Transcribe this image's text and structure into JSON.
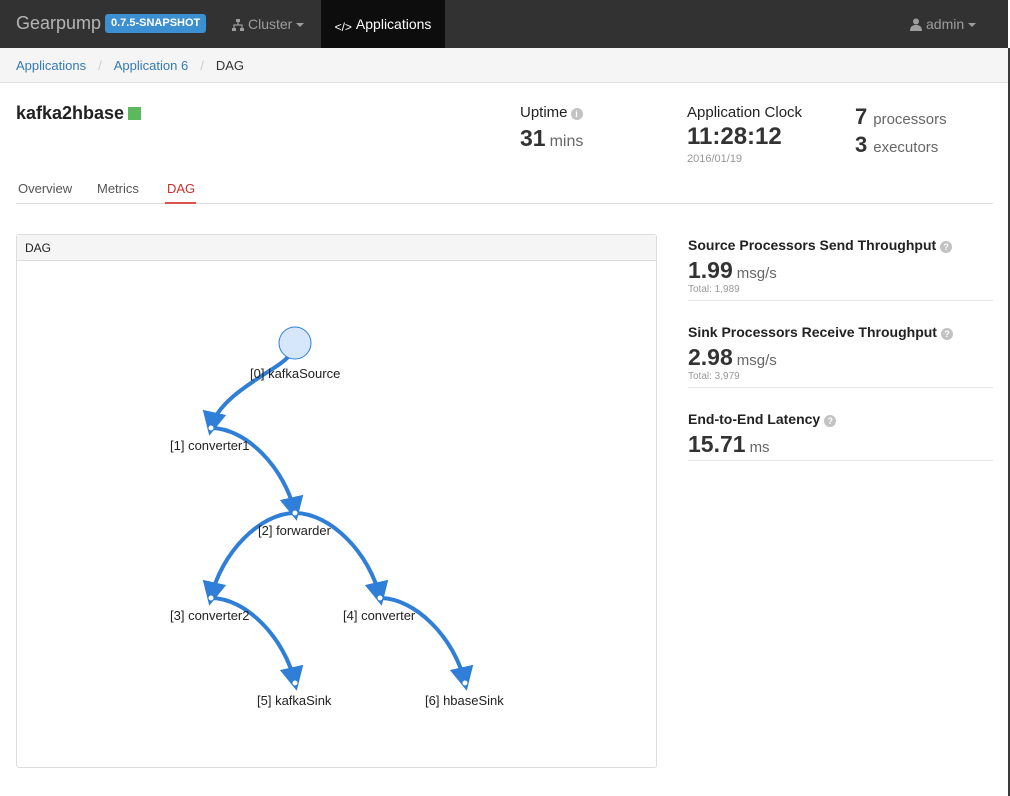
{
  "navbar": {
    "brand": "Gearpump",
    "version": "0.7.5-SNAPSHOT",
    "cluster_label": "Cluster",
    "applications_label": "Applications",
    "user_label": "admin"
  },
  "breadcrumb": {
    "items": [
      "Applications",
      "Application 6",
      "DAG"
    ]
  },
  "app": {
    "name": "kafka2hbase",
    "status_color": "#5cb85c"
  },
  "summary": {
    "uptime_label": "Uptime",
    "uptime_value": "31",
    "uptime_unit": "mins",
    "clock_label": "Application Clock",
    "clock_value": "11:28:12",
    "clock_date": "2016/01/19",
    "processors_count": "7",
    "processors_label": "processors",
    "executors_count": "3",
    "executors_label": "executors"
  },
  "tabs": [
    "Overview",
    "Metrics",
    "DAG"
  ],
  "active_tab": "DAG",
  "dag": {
    "panel_title": "DAG",
    "nodes": [
      "[0] kafkaSource",
      "[1] converter1",
      "[2] forwarder",
      "[3] converter2",
      "[4] converter",
      "[5] kafkaSink",
      "[6] hbaseSink"
    ],
    "edges": [
      [
        0,
        1
      ],
      [
        1,
        2
      ],
      [
        2,
        3
      ],
      [
        2,
        4
      ],
      [
        3,
        5
      ],
      [
        4,
        6
      ]
    ],
    "edge_color": "#2f7ed8"
  },
  "metrics": {
    "source_title": "Source Processors Send Throughput",
    "source_value": "1.99",
    "source_unit": "msg/s",
    "source_total": "Total: 1,989",
    "sink_title": "Sink Processors Receive Throughput",
    "sink_value": "2.98",
    "sink_unit": "msg/s",
    "sink_total": "Total: 3,979",
    "latency_title": "End-to-End Latency",
    "latency_value": "15.71",
    "latency_unit": "ms"
  }
}
